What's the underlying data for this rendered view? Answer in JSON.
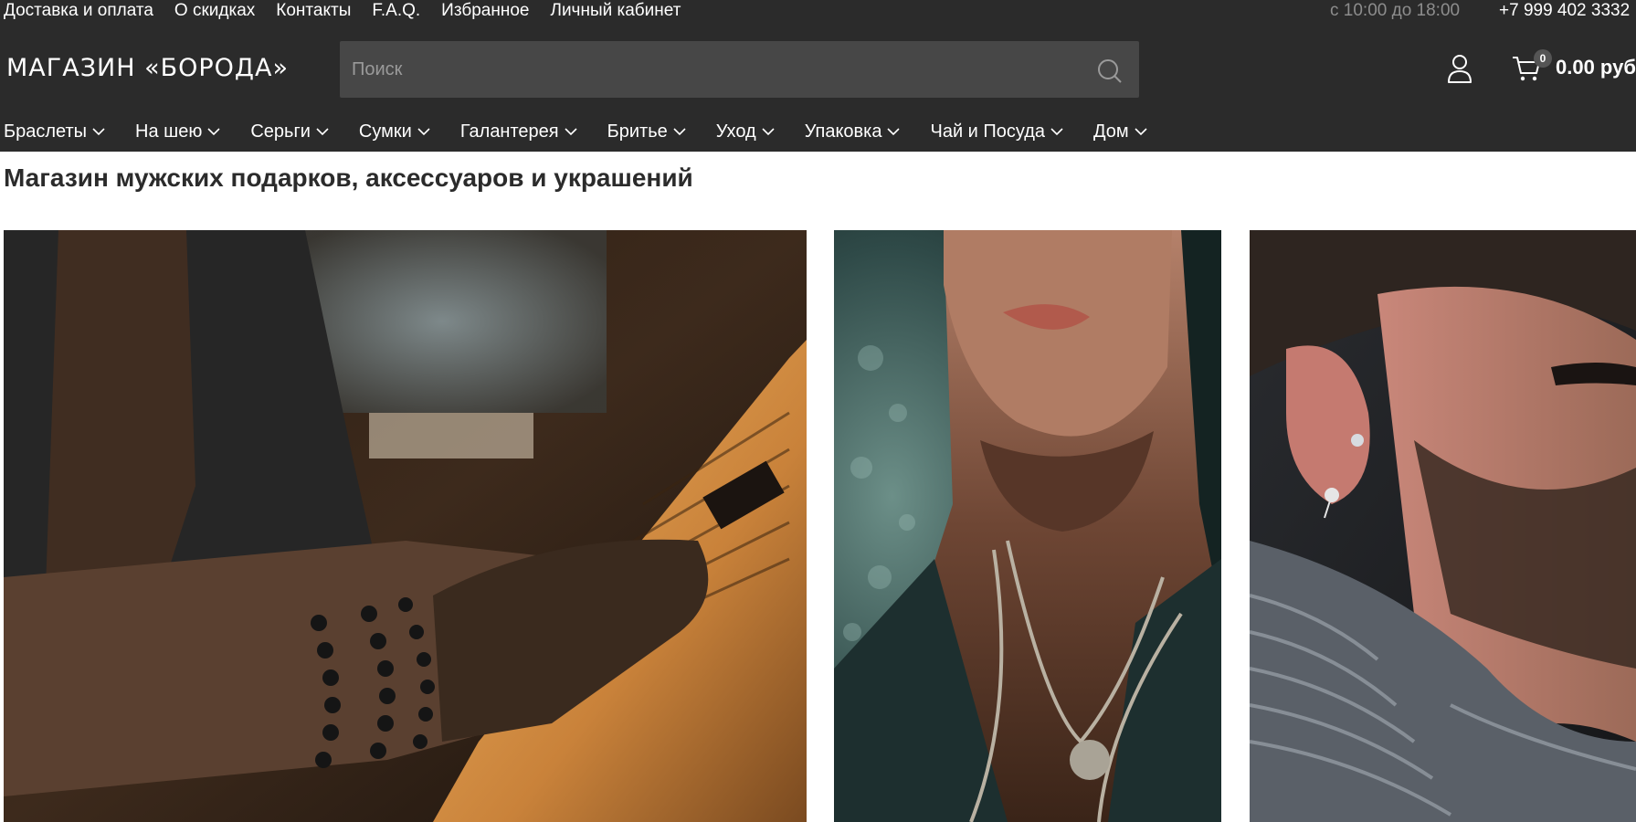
{
  "topbar": {
    "links": [
      "Доставка и оплата",
      "О скидках",
      "Контакты",
      "F.A.Q.",
      "Избранное",
      "Личный кабинет"
    ],
    "hours": "с 10:00 до 18:00",
    "phone": "+7 999 402 3332"
  },
  "header": {
    "logo": "МАГАЗИН «БОРОДА»",
    "search_placeholder": "Поиск",
    "search_icon": "search-icon",
    "user_icon": "user-icon",
    "cart_icon": "cart-icon",
    "cart_count": "0",
    "cart_total": "0.00 руб"
  },
  "categories": [
    "Браслеты",
    "На шею",
    "Серьги",
    "Сумки",
    "Галантерея",
    "Бритье",
    "Уход",
    "Упаковка",
    "Чай и Посуда",
    "Дом"
  ],
  "main": {
    "title": "Магазин мужских подарков, аксессуаров и украшений"
  },
  "colors": {
    "header_bg": "#2b2b2b",
    "search_bg": "#474747",
    "text_light": "#ffffff",
    "text_muted": "#8d8d8d"
  }
}
